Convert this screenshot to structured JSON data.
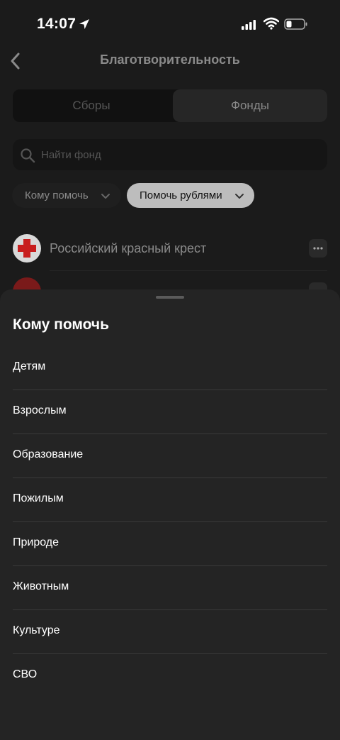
{
  "status_bar": {
    "time": "14:07"
  },
  "header": {
    "title": "Благотворительность"
  },
  "tabs": [
    {
      "label": "Сборы",
      "active": false
    },
    {
      "label": "Фонды",
      "active": true
    }
  ],
  "search": {
    "placeholder": "Найти фонд"
  },
  "filters": [
    {
      "label": "Кому помочь",
      "selected": false
    },
    {
      "label": "Помочь рублями",
      "selected": true
    }
  ],
  "funds": [
    {
      "name": "Российский красный крест"
    }
  ],
  "sheet": {
    "title": "Кому помочь",
    "options": [
      {
        "label": "Детям"
      },
      {
        "label": "Взрослым"
      },
      {
        "label": "Образование"
      },
      {
        "label": "Пожилым"
      },
      {
        "label": "Природе"
      },
      {
        "label": "Животным"
      },
      {
        "label": "Культуре"
      },
      {
        "label": "СВО"
      }
    ]
  },
  "colors": {
    "background": "#1b1b1b",
    "sheet": "#242424",
    "text": "#ffffff",
    "muted": "#8a8a8a",
    "red_cross": "#c81e1e"
  }
}
